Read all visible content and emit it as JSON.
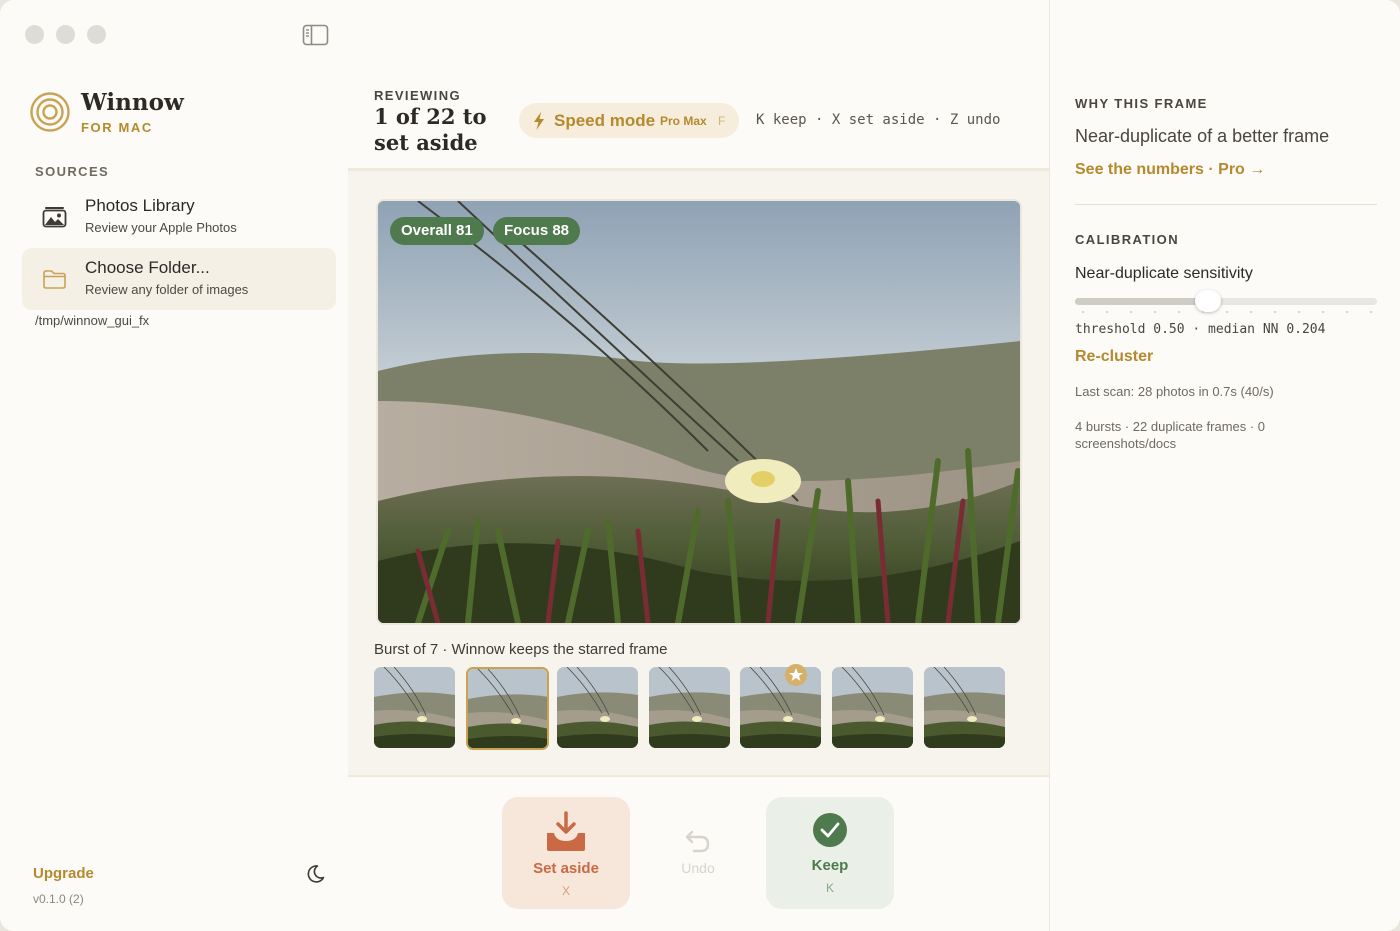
{
  "app": {
    "name": "Winnow",
    "subtitle": "FOR MAC",
    "brand_color": "#b58a2e"
  },
  "sidebar": {
    "sources_label": "SOURCES",
    "sources": [
      {
        "title": "Photos Library",
        "subtitle": "Review your Apple Photos",
        "icon": "photos-library-icon",
        "active": false
      },
      {
        "title": "Choose Folder...",
        "subtitle": "Review any folder of images",
        "icon": "folder-icon",
        "active": true
      }
    ],
    "folder_path": "/tmp/winnow_gui_fx",
    "upgrade_label": "Upgrade",
    "version": "v0.1.0 (2)",
    "theme_icon": "moon-icon"
  },
  "header": {
    "reviewing_label": "REVIEWING",
    "review_title": "1 of 22 to set aside",
    "speed_mode": {
      "label": "Speed mode",
      "tag": "Pro Max",
      "key": "F",
      "icon": "bolt-icon"
    },
    "shortcuts": "K keep · X set aside · Z undo"
  },
  "viewer": {
    "badges": [
      {
        "label": "Overall 81"
      },
      {
        "label": "Focus 88"
      }
    ],
    "burst_caption": "Burst of 7 · Winnow keeps the starred frame",
    "thumbnails": [
      {
        "starred": true,
        "selected": false
      },
      {
        "starred": false,
        "selected": true
      },
      {
        "starred": false,
        "selected": false
      },
      {
        "starred": false,
        "selected": false
      },
      {
        "starred": false,
        "selected": false
      },
      {
        "starred": false,
        "selected": false
      },
      {
        "starred": false,
        "selected": false
      }
    ]
  },
  "actions": {
    "set_aside": {
      "label": "Set aside",
      "key": "X",
      "icon": "tray-download-icon"
    },
    "undo": {
      "label": "Undo",
      "icon": "undo-arrow-icon"
    },
    "keep": {
      "label": "Keep",
      "key": "K",
      "icon": "check-circle-icon"
    }
  },
  "inspector": {
    "why_label": "WHY THIS FRAME",
    "why_headline": "Near-duplicate of a better frame",
    "numbers_link": "See the numbers · Pro →",
    "calibration_label": "CALIBRATION",
    "sensitivity_label": "Near-duplicate sensitivity",
    "sensitivity_value": 0.44,
    "threshold_line": "threshold 0.50 · median NN 0.204",
    "recluster_label": "Re-cluster",
    "scan_info": "Last scan: 28 photos in 0.7s (40/s)",
    "bursts_info": "4 bursts · 22 duplicate frames · 0 screenshots/docs"
  }
}
